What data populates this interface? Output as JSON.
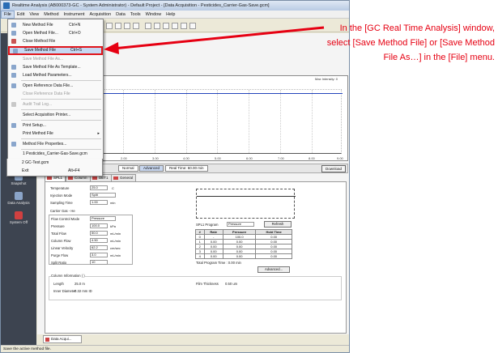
{
  "window": {
    "title": "Realtime Analysis (AB000373-GC - System Administrator) - Default Project - [Data Acquisition - Pesticides_Carrier-Gas-Save.gcm]"
  },
  "menubar": [
    "File",
    "Edit",
    "View",
    "Method",
    "Instrument",
    "Acquisition",
    "Data",
    "Tools",
    "Window",
    "Help"
  ],
  "file_menu": {
    "items": [
      {
        "label": "New Method File",
        "shortcut": "Ctrl+N",
        "disabled": false
      },
      {
        "label": "Open Method File...",
        "shortcut": "Ctrl+O",
        "disabled": false
      },
      {
        "label": "Close Method File",
        "shortcut": "",
        "disabled": false
      },
      {
        "label": "Save Method File",
        "shortcut": "Ctrl+S",
        "disabled": false,
        "highlighted": true
      },
      {
        "label": "Save Method File As...",
        "shortcut": "",
        "disabled": true
      },
      {
        "label": "Save Method File As Template...",
        "shortcut": "",
        "disabled": false
      },
      {
        "label": "Load Method Parameters...",
        "shortcut": "",
        "disabled": false
      },
      {
        "label": "Open Reference Data File...",
        "shortcut": "",
        "disabled": false
      },
      {
        "label": "Close Reference Data File",
        "shortcut": "",
        "disabled": true
      },
      {
        "label": "Audit Trail Log...",
        "shortcut": "",
        "disabled": true
      },
      {
        "label": "Select Acquisition Printer...",
        "shortcut": "",
        "disabled": false
      },
      {
        "label": "Print Setup...",
        "shortcut": "",
        "disabled": false
      },
      {
        "label": "Print Method File",
        "shortcut": "",
        "disabled": false
      },
      {
        "label": "Method File Properties...",
        "shortcut": "",
        "disabled": false
      },
      {
        "label": "1 Pesticides_Carrier-Gas-Save.gcm",
        "shortcut": "",
        "disabled": false
      },
      {
        "label": "2 GC-Test.gcm",
        "shortcut": "",
        "disabled": false
      },
      {
        "label": "Exit",
        "shortcut": "Alt+F4",
        "disabled": false
      }
    ]
  },
  "left_panel": [
    {
      "label": "Stop"
    },
    {
      "label": "Snapshot"
    },
    {
      "label": "Data Analysis"
    },
    {
      "label": "System Off"
    }
  ],
  "chart": {
    "header": "FID1: Ext",
    "right_header": "Max Intensity: 0",
    "x_ticks": [
      "0.00",
      "1.00",
      "2.00",
      "3.00",
      "4.00",
      "5.00",
      "6.00",
      "7.00",
      "8.00",
      "9.00"
    ]
  },
  "instrument_view": {
    "title": "Instrument Parameter View",
    "normal": "Normal",
    "advanced": "Advanced",
    "real_time": "Real Time: 60.00 min",
    "download": "Download"
  },
  "tabs": [
    "SPL1",
    "Column",
    "DET1",
    "General"
  ],
  "spl": {
    "temperature_label": "Temperature",
    "temperature": "25.0",
    "temperature_unit": "C",
    "injection_mode_label": "Injection Mode",
    "injection_mode": "Split",
    "sampling_time_label": "Sampling Time",
    "sampling_time": "1.00",
    "sampling_time_unit": "min",
    "carrier_gas_label": "Carrier Gas - He",
    "flow_control_label": "Flow Control Mode",
    "flow_control": "Pressure",
    "pressure_label": "Pressure",
    "pressure": "100.0",
    "pressure_unit": "kPa",
    "total_flow_label": "Total Flow",
    "total_flow": "50.0",
    "total_flow_unit": "mL/min",
    "column_flow_label": "Column Flow",
    "column_flow": "4.50",
    "column_flow_unit": "mL/min",
    "linear_velocity_label": "Linear Velocity",
    "linear_velocity": "62.2",
    "linear_velocity_unit": "cm/sec",
    "purge_flow_label": "Purge Flow",
    "purge_flow": "3.0",
    "purge_flow_unit": "mL/min",
    "split_ratio_label": "Split Ratio",
    "split_ratio": "10"
  },
  "program": {
    "label": "SPL1 Program",
    "mode": "Pressure",
    "refresh": "Refresh",
    "headers": [
      "#",
      "Rate",
      "Pressure",
      "Hold Time"
    ],
    "rows": [
      [
        "0",
        "-",
        "100.0",
        "0.00"
      ],
      [
        "1",
        "0.00",
        "0.00",
        "0.00"
      ],
      [
        "2",
        "0.00",
        "0.00",
        "0.00"
      ],
      [
        "3",
        "0.00",
        "0.00",
        "0.00"
      ],
      [
        "4",
        "0.00",
        "0.00",
        "0.00"
      ]
    ],
    "total_time": "Total Program Time : 0.00 min",
    "advanced": "Advanced..."
  },
  "column_info": {
    "title": "Column Information ( )",
    "length_label": "Length",
    "length": "25.0 m",
    "inner_diameter_label": "Inner Diameter",
    "inner_diameter": "0.32 mm ID",
    "film_label": "Film Thickness",
    "film": "0.50 um"
  },
  "bottom_tab": "Data Acqui...",
  "status": "Save the active method file.",
  "annotation": {
    "text": "In the [GC Real Time Analysis] window, select [Save Method File] or [Save Method File As…] in the [File] menu."
  },
  "colors": {
    "annotation": "#e60012",
    "highlight_border": "#e0151b",
    "trace": "#2244bb"
  }
}
